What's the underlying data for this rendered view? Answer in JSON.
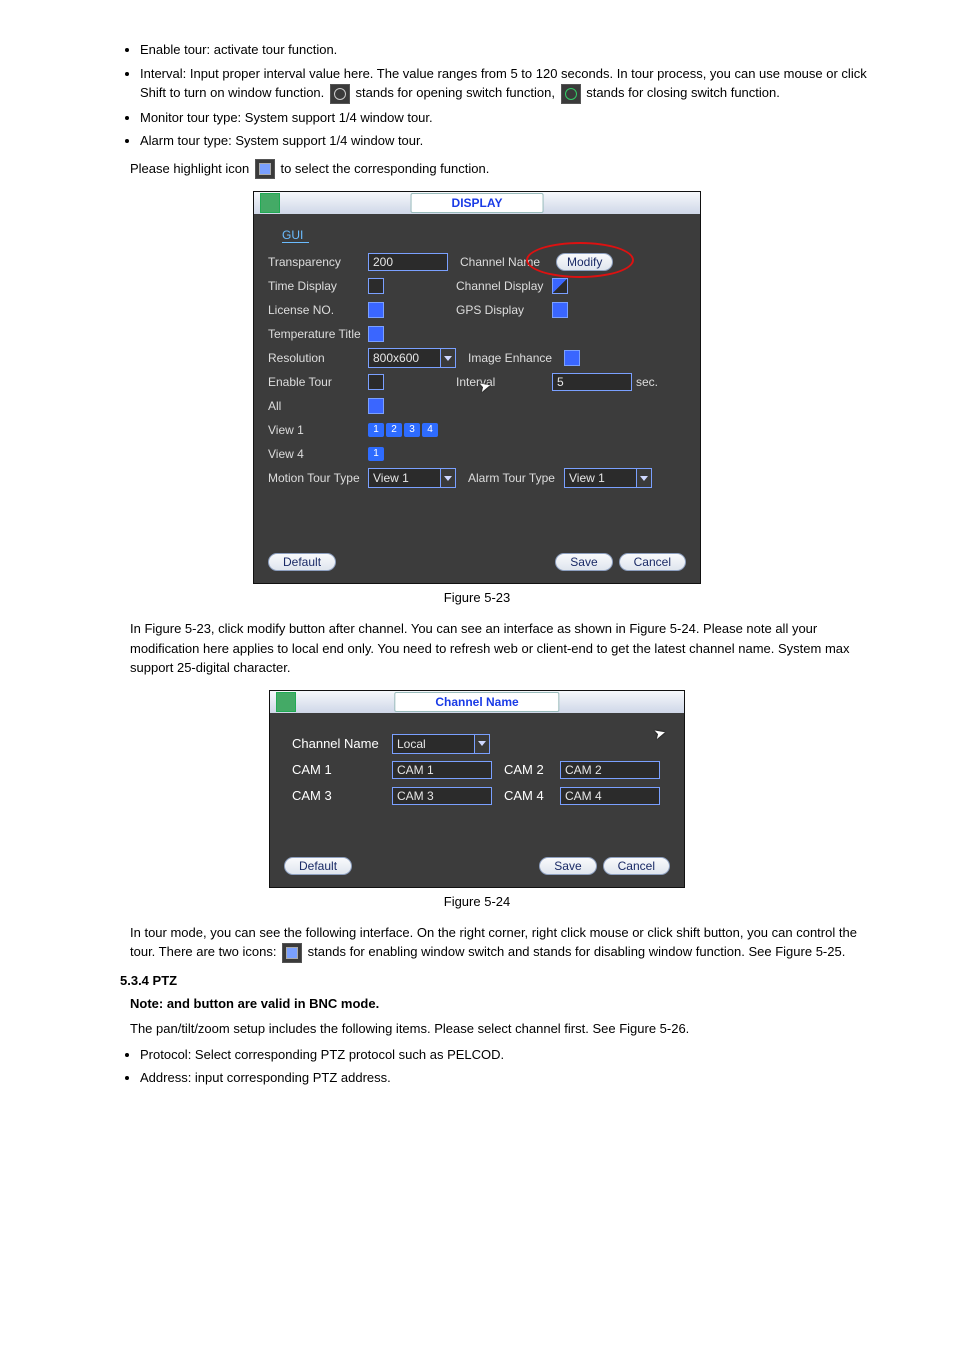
{
  "bullets_top": [
    "Enable tour: activate tour function.",
    "Interval: Input proper interval value here. The value ranges from 5 to 120 seconds. In tour process, you can use mouse or click Shift to turn on window function.   stands for opening switch function,   stands for closing switch function.",
    "Monitor tour type: System support 1/4 window tour.",
    "Alarm tour type: System support 1/4 window tour."
  ],
  "para_highlight": "Please highlight icon   to select the corresponding function.",
  "display_dialog": {
    "title": "DISPLAY",
    "section": "GUI",
    "labels": {
      "transparency": "Transparency",
      "channel_name": "Channel Name",
      "modify": "Modify",
      "time_display": "Time Display",
      "channel_display": "Channel Display",
      "license_no": "License NO.",
      "gps_display": "GPS Display",
      "temperature_title": "Temperature Title",
      "resolution": "Resolution",
      "image_enhance": "Image Enhance",
      "enable_tour": "Enable Tour",
      "interval": "Interval",
      "sec": "sec.",
      "all": "All",
      "view1": "View 1",
      "view4": "View 4",
      "motion_tour_type": "Motion Tour Type",
      "alarm_tour_type": "Alarm Tour Type"
    },
    "values": {
      "transparency": "200",
      "resolution": "800x600",
      "interval": "5",
      "motion_tour": "View 1",
      "alarm_tour": "View 1"
    },
    "buttons": {
      "default": "Default",
      "save": "Save",
      "cancel": "Cancel"
    }
  },
  "fig1_caption": "Figure 5-23",
  "fig2_caption": "Figure 5-24",
  "after_display": "In Figure 5-23, click modify button after channel. You can see an interface as shown in Figure 5-24. Please note all your modification here applies to local end only. You need to refresh web or client-end to get the latest channel name. System max support 25-digital character.",
  "channel_name_dialog": {
    "title": "Channel Name",
    "labels": {
      "channel_name": "Channel Name",
      "cam1": "CAM 1",
      "cam2": "CAM 2",
      "cam3": "CAM 3",
      "cam4": "CAM 4"
    },
    "values": {
      "scope": "Local",
      "cam1": "CAM 1",
      "cam2": "CAM 2",
      "cam3": "CAM 3",
      "cam4": "CAM 4"
    },
    "buttons": {
      "default": "Default",
      "save": "Save",
      "cancel": "Cancel"
    }
  },
  "after_channel": "In tour mode, you can see the following interface. On the right corner, right click mouse or click shift button, you can control the tour. There are two icons:   stands for enabling window switch and   stands for disabling window function. See Figure 5-25.",
  "heading_ptz": "5.3.4 PTZ",
  "ptz_note": "Note: and button are valid in BNC mode.",
  "ptz_intro": "The pan/tilt/zoom setup includes the following items. Please select channel first. See Figure 5-26.",
  "bullets_bottom": [
    "Protocol: Select corresponding PTZ protocol such as PELCOD.",
    "Address: input corresponding PTZ address."
  ]
}
